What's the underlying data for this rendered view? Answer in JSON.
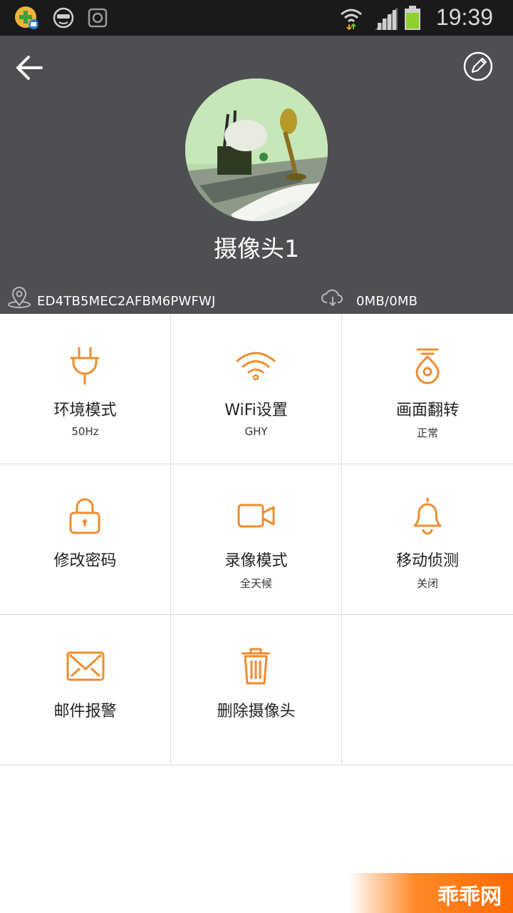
{
  "status_bar": {
    "time": "19:39",
    "icons": [
      "app-notification-icon",
      "face-icon",
      "camera-app-icon",
      "wifi-icon",
      "signal-icon",
      "battery-icon"
    ]
  },
  "header": {
    "back_icon": "back-arrow-icon",
    "edit_icon": "edit-icon",
    "camera_name": "摄像头1",
    "device_id": "ED4TB5MEC2AFBM6PWFWJ",
    "storage": "0MB/0MB",
    "location_icon": "location-icon",
    "cloud_icon": "cloud-download-icon"
  },
  "grid": {
    "items": [
      {
        "label": "环境模式",
        "value": "50Hz",
        "icon": "plug-icon"
      },
      {
        "label": "WiFi设置",
        "value": "GHY",
        "icon": "wifi-icon"
      },
      {
        "label": "画面翻转",
        "value": "正常",
        "icon": "flip-icon"
      },
      {
        "label": "修改密码",
        "value": "",
        "icon": "lock-icon"
      },
      {
        "label": "录像模式",
        "value": "全天候",
        "icon": "video-icon"
      },
      {
        "label": "移动侦测",
        "value": "关闭",
        "icon": "bell-icon"
      },
      {
        "label": "邮件报警",
        "value": "",
        "icon": "mail-icon"
      },
      {
        "label": "删除摄像头",
        "value": "",
        "icon": "trash-icon"
      }
    ]
  },
  "watermark": {
    "text": "乖乖网"
  },
  "colors": {
    "accent": "#f08c2e",
    "header_bg": "#4d4f52",
    "status_bg": "#1a1a1a"
  }
}
